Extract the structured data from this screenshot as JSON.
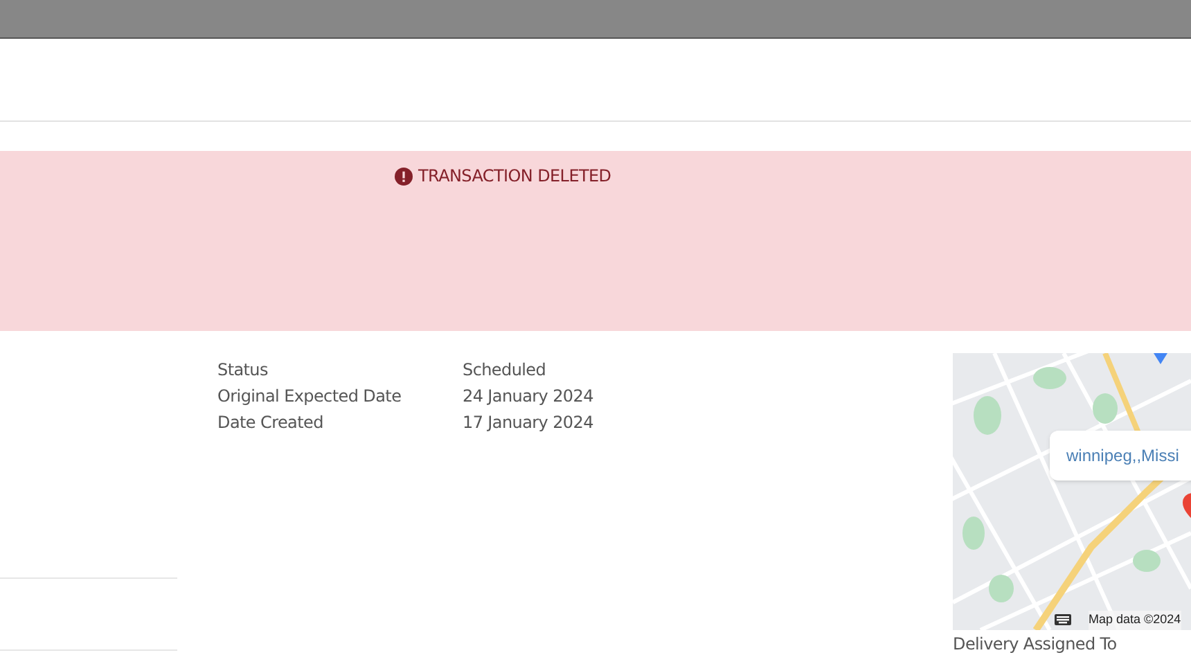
{
  "banner": {
    "message": "TRANSACTION DELETED"
  },
  "details": [
    {
      "label": "Status",
      "value": "Scheduled"
    },
    {
      "label": "Original Expected Date",
      "value": "24 January 2024"
    },
    {
      "label": "Date Created",
      "value": "17 January 2024"
    }
  ],
  "map": {
    "kind": "picture",
    "popup": "winnipeg,,Missi",
    "attribution": "Map data ©2024"
  },
  "delivery": {
    "label": "Delivery Assigned To"
  }
}
